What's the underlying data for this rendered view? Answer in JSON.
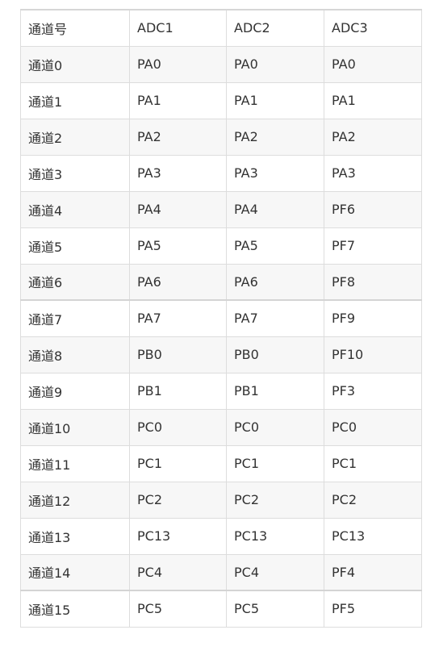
{
  "table": {
    "headers": [
      "通道号",
      "ADC1",
      "ADC2",
      "ADC3"
    ],
    "rows": [
      [
        "通道0",
        "PA0",
        "PA0",
        "PA0"
      ],
      [
        "通道1",
        "PA1",
        "PA1",
        "PA1"
      ],
      [
        "通道2",
        "PA2",
        "PA2",
        "PA2"
      ],
      [
        "通道3",
        "PA3",
        "PA3",
        "PA3"
      ],
      [
        "通道4",
        "PA4",
        "PA4",
        "PF6"
      ],
      [
        "通道5",
        "PA5",
        "PA5",
        "PF7"
      ],
      [
        "通道6",
        "PA6",
        "PA6",
        "PF8"
      ],
      [
        "通道7",
        "PA7",
        "PA7",
        "PF9"
      ],
      [
        "通道8",
        "PB0",
        "PB0",
        "PF10"
      ],
      [
        "通道9",
        "PB1",
        "PB1",
        "PF3"
      ],
      [
        "通道10",
        "PC0",
        "PC0",
        "PC0"
      ],
      [
        "通道11",
        "PC1",
        "PC1",
        "PC1"
      ],
      [
        "通道12",
        "PC2",
        "PC2",
        "PC2"
      ],
      [
        "通道13",
        "PC13",
        "PC13",
        "PC13"
      ],
      [
        "通道14",
        "PC4",
        "PC4",
        "PF4"
      ],
      [
        "通道15",
        "PC5",
        "PC5",
        "PF5"
      ]
    ]
  }
}
